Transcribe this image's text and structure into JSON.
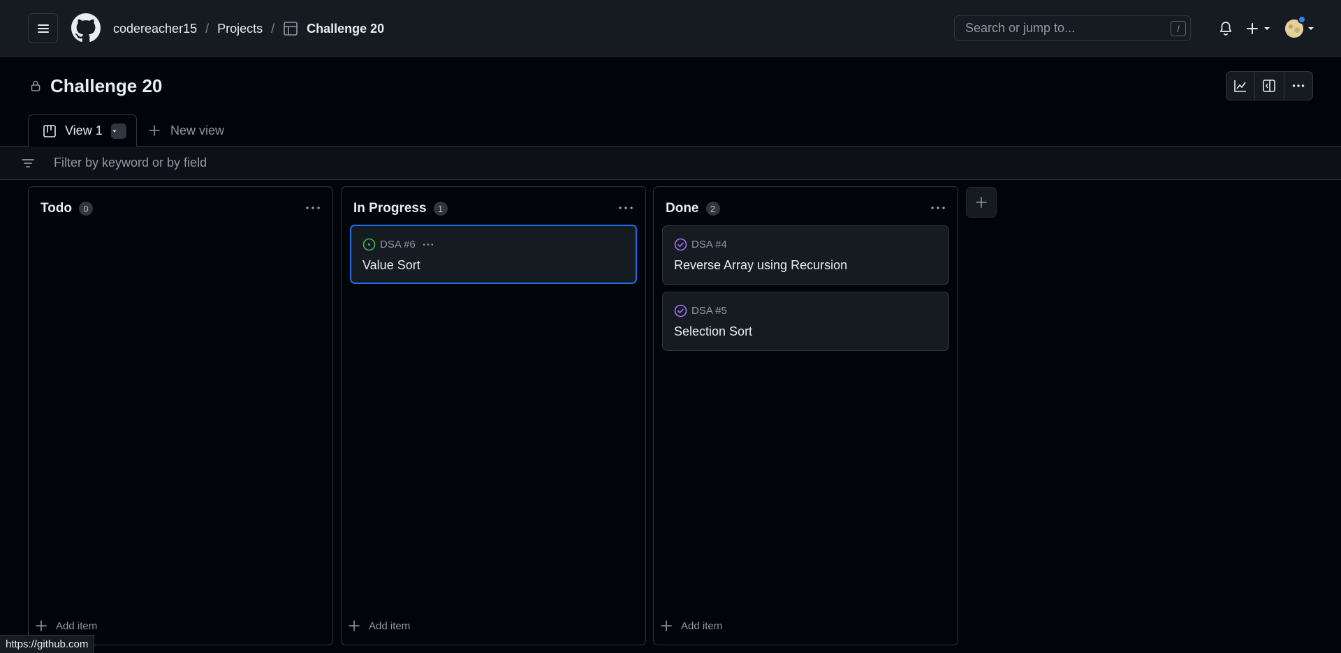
{
  "header": {
    "breadcrumb": [
      {
        "label": "codereacher15"
      },
      {
        "label": "Projects"
      },
      {
        "label": "Challenge 20"
      }
    ],
    "search": {
      "placeholder": "Search or jump to...",
      "shortcut": "/"
    },
    "icons": [
      "menu-icon",
      "github-logo",
      "table-icon",
      "bell-icon",
      "plus-icon",
      "avatar"
    ]
  },
  "project": {
    "title": "Challenge 20",
    "actions": [
      "insights-icon",
      "side-panel-icon",
      "kebab-icon"
    ]
  },
  "views": {
    "tabs": [
      {
        "label": "View 1"
      }
    ],
    "new_view_label": "New view"
  },
  "filter": {
    "placeholder": "Filter by keyword or by field"
  },
  "board": {
    "columns": [
      {
        "title": "Todo",
        "count": "0",
        "cards": [],
        "add_label": "Add item"
      },
      {
        "title": "In Progress",
        "count": "1",
        "cards": [
          {
            "ref": "DSA #6",
            "title": "Value Sort",
            "status": "open"
          }
        ],
        "add_label": "Add item"
      },
      {
        "title": "Done",
        "count": "2",
        "cards": [
          {
            "ref": "DSA #4",
            "title": "Reverse Array using Recursion",
            "status": "closed"
          },
          {
            "ref": "DSA #5",
            "title": "Selection Sort",
            "status": "closed"
          }
        ],
        "add_label": "Add item"
      }
    ]
  },
  "status_bar": {
    "url": "https://github.com"
  },
  "colors": {
    "accent": "#1f6feb",
    "open": "#3fb950",
    "done": "#a371f7",
    "bg": "#010409"
  }
}
